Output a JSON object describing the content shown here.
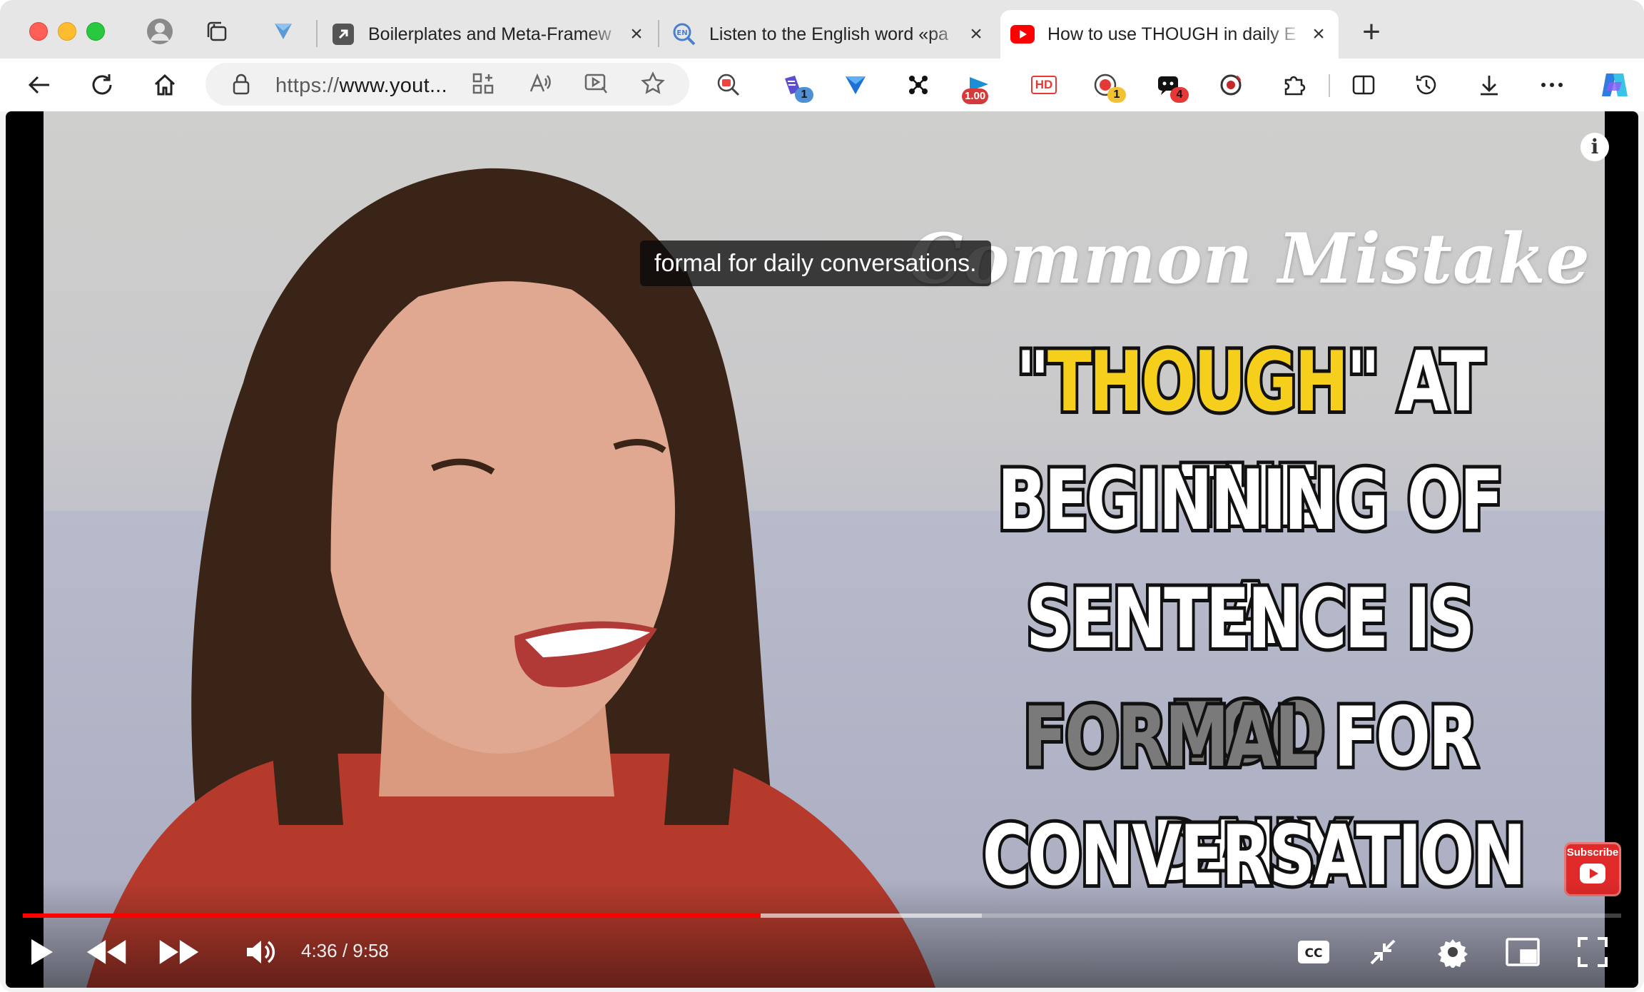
{
  "tabs": [
    {
      "title": "Boilerplates and Meta-Framew",
      "favicon": "arrow-link-icon",
      "active": false
    },
    {
      "title": "Listen to the English word «pa",
      "favicon": "magnifier-en-icon",
      "active": false
    },
    {
      "title": "How to use THOUGH in daily E",
      "favicon": "youtube-icon",
      "active": true
    }
  ],
  "address_bar": {
    "scheme": "https://",
    "rest": "www.yout..."
  },
  "extensions": {
    "badge_1": "1",
    "rate_label": "1.00",
    "hd_label": "HD",
    "badge_red_dot": "1",
    "badge_4": "4"
  },
  "video": {
    "caption": "formal for daily conversations.",
    "overlay_script": "Common Mistake",
    "overlay_lines": {
      "l1_quote_open": "\"",
      "l1_word": "THOUGH",
      "l1_rest": "\" AT THE",
      "l2": "BEGINNING OF A",
      "l3_a": "SENTENCE IS ",
      "l3_b": "TOO",
      "l4_a": "FORMAL",
      "l4_b": " FOR DAILY",
      "l5": "CONVERSATION"
    },
    "info_label": "i",
    "subscribe_label": "Subscribe",
    "time_display": "4:36 / 9:58",
    "played_fraction": 0.4617,
    "buffered_fraction": 0.6
  },
  "colors": {
    "progress": "#ff0000",
    "overlay_yellow": "#f5cf1b",
    "youtube_red": "#ff0000",
    "subscribe": "#e02a2a"
  }
}
